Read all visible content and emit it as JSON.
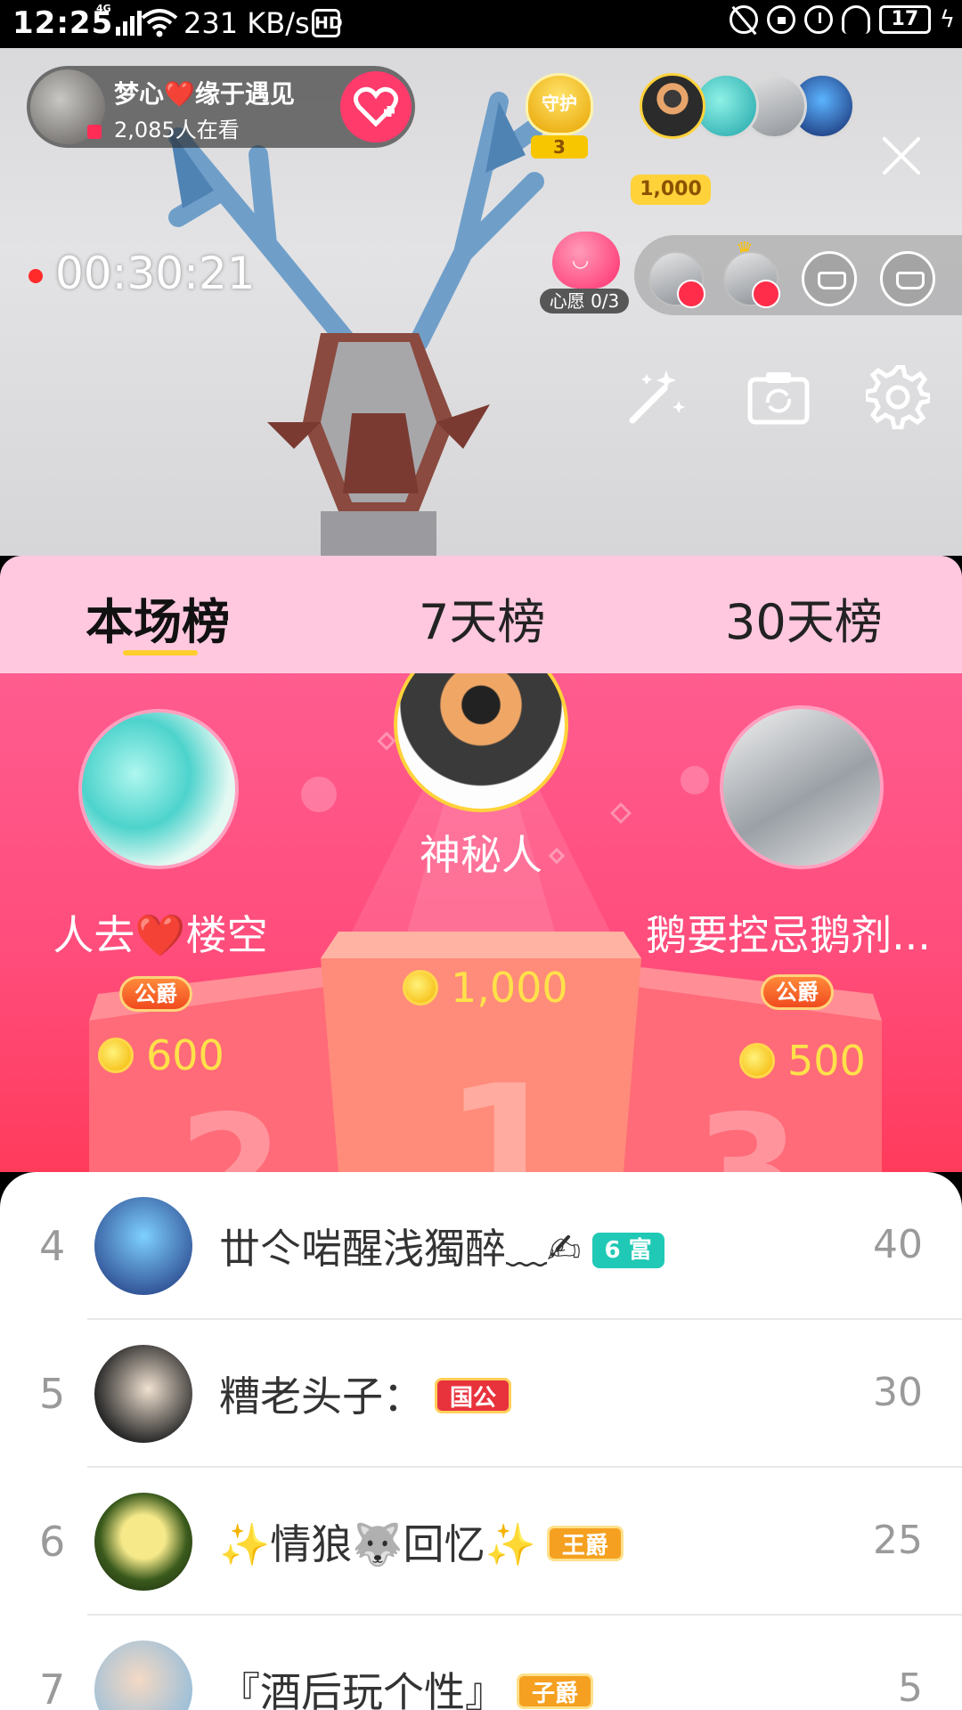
{
  "status_bar": {
    "time": "12:25",
    "network": "4G",
    "speed": "231 KB/s",
    "hd": "HD",
    "battery": "17"
  },
  "live": {
    "host_name": "梦心❤️缘于遇见",
    "viewers": "2,085人在看",
    "guard_label": "守护",
    "guard_count": "3",
    "top_gift_amount": "1,000",
    "elapsed": "00:30:21",
    "wish_label": "心愿 0/3"
  },
  "tabs": [
    {
      "label": "本场榜",
      "active": true
    },
    {
      "label": "7天榜",
      "active": false
    },
    {
      "label": "30天榜",
      "active": false
    }
  ],
  "podium": {
    "first": {
      "name": "神秘人",
      "amount": "1,000"
    },
    "second": {
      "name": "人去❤️楼空",
      "badge": "公爵",
      "amount": "600"
    },
    "third": {
      "name": "鹅要控忌鹅剂...",
      "badge": "公爵",
      "amount": "500"
    }
  },
  "list": [
    {
      "rank": "4",
      "name": "丗仒啱醒浅獨醉﹏✍",
      "badge": "6 富",
      "score": "40"
    },
    {
      "rank": "5",
      "name": "糟老头子：",
      "badge": "国公",
      "score": "30"
    },
    {
      "rank": "6",
      "name": "✨情狼🐺回忆✨",
      "badge": "王爵",
      "score": "25"
    },
    {
      "rank": "7",
      "name": "『酒后玩个性』",
      "badge": "子爵",
      "score": "5"
    }
  ],
  "colors": {
    "tab_bg": "#ffc8df",
    "podium_top": "#ff5c8f",
    "podium_bottom": "#ff3b5c",
    "amount_gold": "#ffe14a",
    "badge_teal": "#20c9b5",
    "badge_red": "#e8323c",
    "badge_orange": "#f5a020"
  }
}
